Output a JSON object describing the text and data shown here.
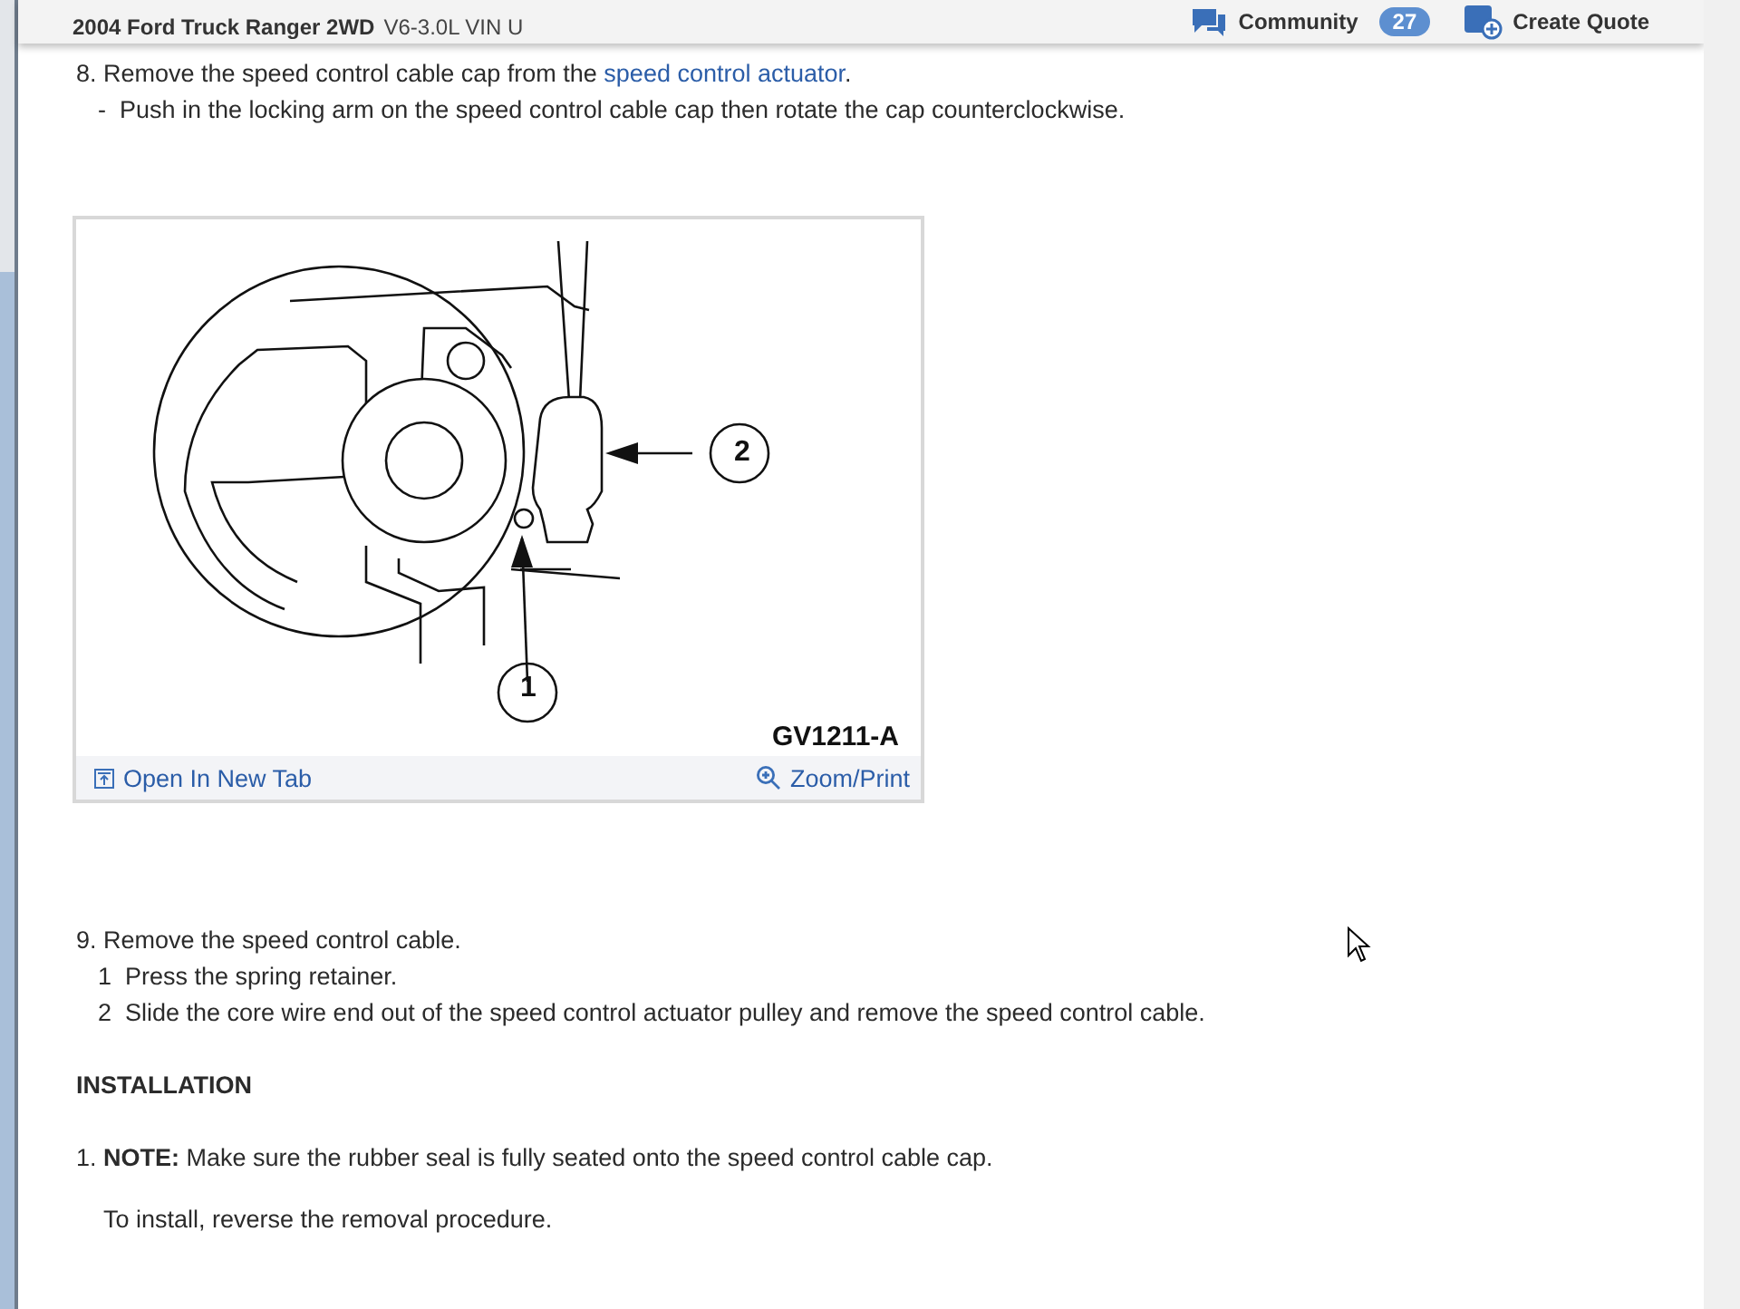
{
  "header": {
    "title": "2004 Ford Truck Ranger 2WD",
    "subtitle": "V6-3.0L VIN U",
    "community": {
      "label": "Community",
      "count": "27"
    },
    "create_quote": "Create Quote"
  },
  "removal_steps": [
    {
      "number": "8.",
      "parts": [
        {
          "kind": "text",
          "text": "Remove the speed control cable cap from the "
        },
        {
          "kind": "link",
          "text": "speed control actuator"
        },
        {
          "kind": "text",
          "text": "."
        }
      ],
      "substeps": [
        {
          "marker": "-",
          "text": "Push in the locking arm on the speed control cable cap then rotate the cap counterclockwise."
        }
      ],
      "figure": {
        "callouts": [
          "1",
          "2"
        ],
        "code": "GV1211-A",
        "open_link": "Open In New Tab",
        "zoom_link": "Zoom/Print"
      }
    },
    {
      "number": "9.",
      "parts": [
        {
          "kind": "text",
          "text": "Remove the speed control cable."
        }
      ],
      "substeps": [
        {
          "marker": "1",
          "text": "Press the spring retainer."
        },
        {
          "marker": "2",
          "text": "Slide the core wire end out of the speed control actuator pulley and remove the speed control cable."
        }
      ]
    }
  ],
  "installation": {
    "heading": "INSTALLATION",
    "steps": [
      {
        "number": "1.",
        "note_label": "NOTE:",
        "text": "Make sure the rubber seal is fully seated onto the speed control cable cap.",
        "followup": "To install, reverse the removal procedure."
      }
    ]
  }
}
